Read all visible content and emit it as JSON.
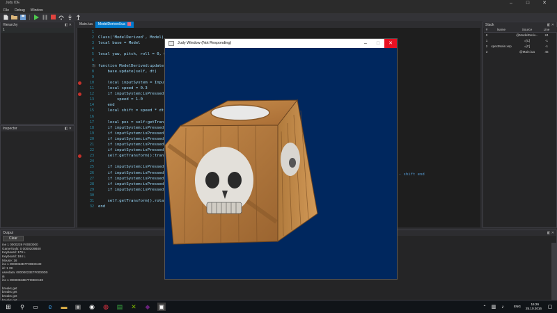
{
  "app": {
    "title": "Judy IDE"
  },
  "menu": [
    "File",
    "Debug",
    "Window"
  ],
  "panels": {
    "hierarchy": "Hierarchy",
    "inspector": "Inspector",
    "output": "Output",
    "stack": "Stack",
    "hierarchy_row": "1"
  },
  "tabs": [
    "Main.lua",
    "ModelDerived.lua"
  ],
  "editor": {
    "lines": [
      {
        "n": "1",
        "t": ""
      },
      {
        "n": "2",
        "t": "Class('ModelDerived', Model)"
      },
      {
        "n": "3",
        "t": "local base = Model"
      },
      {
        "n": "4",
        "t": ""
      },
      {
        "n": "5",
        "t": "local yaw, pitch, roll = 0, 0"
      },
      {
        "n": "6",
        "t": ""
      },
      {
        "n": "7",
        "t": "function ModelDerived:update"
      },
      {
        "n": "8",
        "t": "    base.update(self, dt)"
      },
      {
        "n": "9",
        "t": ""
      },
      {
        "n": "10",
        "t": "    local inputSystem = Input"
      },
      {
        "n": "11",
        "t": "    local speed = 0.3"
      },
      {
        "n": "12",
        "t": "    if inputSystem:isPressed("
      },
      {
        "n": "13",
        "t": "        speed = 1.0"
      },
      {
        "n": "14",
        "t": "    end"
      },
      {
        "n": "15",
        "t": "    local shift = speed * dt"
      },
      {
        "n": "16",
        "t": ""
      },
      {
        "n": "17",
        "t": "    local pos = self:getTrans"
      },
      {
        "n": "18",
        "t": "    if inputSystem:isPressed("
      },
      {
        "n": "19",
        "t": "    if inputSystem:isPressed("
      },
      {
        "n": "20",
        "t": "    if inputSystem:isPressed("
      },
      {
        "n": "21",
        "t": "    if inputSystem:isPressed("
      },
      {
        "n": "22",
        "t": "    if inputSystem:isPressed("
      },
      {
        "n": "23",
        "t": "    self:getTransform():trans"
      },
      {
        "n": "24",
        "t": ""
      },
      {
        "n": "25",
        "t": "    if inputSystem:isPressed("
      },
      {
        "n": "26",
        "t": "    if inputSystem:isPressed("
      },
      {
        "n": "27",
        "t": "    if inputSystem:isPressed("
      },
      {
        "n": "28",
        "t": "    if inputSystem:isPressed("
      },
      {
        "n": "29",
        "t": "    if inputSystem:isPressed("
      },
      {
        "n": "30",
        "t": ""
      },
      {
        "n": "31",
        "t": "    self:getTransform().rotat"
      },
      {
        "n": "32",
        "t": "end"
      }
    ],
    "overflow_text": "h - shift end"
  },
  "output": {
    "clear_label": "Clear",
    "lines": [
      "ine 1 0000239 F00E0000",
      "GameTools: 0 0000209B00",
      "Keyboard: 179 L",
      "Keyboard: 184 L",
      "Mouse: 16",
      "inc 1 0000023E7F00E0C30",
      "id: 1 28",
      "userdata: 00000023E7F0000D0",
      "i6",
      "inc 1 00000023E7F00E0C30",
      "",
      "breaks get",
      "breaks get",
      "breaks get",
      "breaks get"
    ]
  },
  "stack": {
    "headers": [
      "#",
      "Name",
      "Source",
      "Line"
    ],
    "rows": [
      [
        "0",
        "",
        "@ModelDeriv...",
        "24"
      ],
      [
        "1",
        "",
        "=[C]",
        "-1"
      ],
      [
        "2",
        "xpectMain.xsp",
        "=[C]",
        "-1"
      ],
      [
        "3",
        "",
        "@Main.lua",
        "46"
      ]
    ]
  },
  "game_window": {
    "title": "Judy Window (Not Responding)",
    "bg_color": "#00275e"
  },
  "taskbar": {
    "time": "16:26",
    "date": "25.10.2016",
    "lang": "ENG"
  },
  "colors": {
    "accent": "#007acc",
    "breakpoint": "#c5312b",
    "close": "#e81123"
  }
}
